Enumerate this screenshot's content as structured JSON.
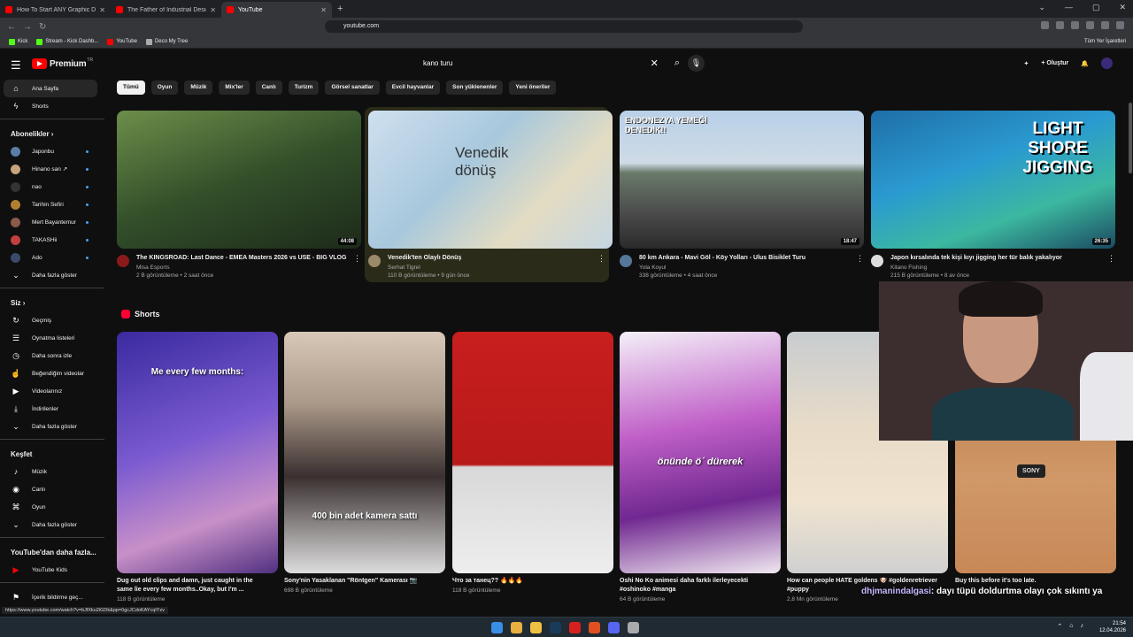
{
  "browser": {
    "tabs": [
      {
        "title": "How To Start ANY Graphic Design Fr",
        "active": false
      },
      {
        "title": "The Father of Industrial Design | Dier",
        "active": false
      },
      {
        "title": "YouTube",
        "active": true
      }
    ],
    "url": "youtube.com",
    "bookmarks": [
      "Kick",
      "Stream - Kick Dashb...",
      "YouTube",
      "Deco My Tree"
    ],
    "bookmarks_right": "Tüm Yer İşaretleri"
  },
  "header": {
    "logo_text": "Premium",
    "logo_tr": "TR",
    "search_query": "kano turu",
    "create_label": "Oluştur"
  },
  "sidebar": {
    "home": "Ana Sayfa",
    "shorts": "Shorts",
    "subs_title": "Abonelikler",
    "subs": [
      {
        "name": "Japonbu",
        "color": "#5a7ea8"
      },
      {
        "name": "Hinano san ↗",
        "color": "#c9a27e"
      },
      {
        "name": "nao",
        "color": "#333333"
      },
      {
        "name": "Tarihin Sefiri",
        "color": "#b08030"
      },
      {
        "name": "Mert Bayantemur",
        "color": "#8a5a4a"
      },
      {
        "name": "TAKASHii",
        "color": "#c04040"
      },
      {
        "name": "Ado",
        "color": "#3a4a6a"
      }
    ],
    "subs_more": "Daha fazla göster",
    "you_title": "Siz",
    "you": [
      {
        "label": "Geçmiş",
        "icon": "history-icon",
        "glyph": "↻"
      },
      {
        "label": "Oynatma listeleri",
        "icon": "playlists-icon",
        "glyph": "☰"
      },
      {
        "label": "Daha sonra izle",
        "icon": "clock-icon",
        "glyph": "◷"
      },
      {
        "label": "Beğendiğim videolar",
        "icon": "thumbs-up-icon",
        "glyph": "☝"
      },
      {
        "label": "Videolarınız",
        "icon": "your-videos-icon",
        "glyph": "▶"
      },
      {
        "label": "İndirilenler",
        "icon": "download-icon",
        "glyph": "⤓"
      },
      {
        "label": "Daha fazla göster",
        "icon": "chevron-down-icon",
        "glyph": "⌄"
      }
    ],
    "explore_title": "Keşfet",
    "explore": [
      {
        "label": "Müzik",
        "icon": "music-icon",
        "glyph": "♪"
      },
      {
        "label": "Canlı",
        "icon": "live-icon",
        "glyph": "◉"
      },
      {
        "label": "Oyun",
        "icon": "gaming-icon",
        "glyph": "⌘"
      },
      {
        "label": "Daha fazla göster",
        "icon": "chevron-down-icon",
        "glyph": "⌄"
      }
    ],
    "more_title": "YouTube'dan daha fazla...",
    "kids": "YouTube Kids",
    "report": "İçerik bildirme geç..."
  },
  "chips": [
    "Tümü",
    "Oyun",
    "Müzik",
    "Mix'ler",
    "Canlı",
    "Turizm",
    "Görsel sanatlar",
    "Evcil hayvanlar",
    "Son yüklenenler",
    "Yeni öneriler"
  ],
  "videos": [
    {
      "title": "The KINGSROAD: Last Dance - EMEA Masters 2026 vs USE - BIG VLOG",
      "channel": "Misa Esports",
      "stats": "2 B görüntüleme • 2 saat önce",
      "duration": "44:08",
      "thumb_text": ""
    },
    {
      "title": "Venedik'ten Olaylı Dönüş",
      "channel": "Serhat Tigrel",
      "stats": "110 B görüntüleme • 9 gün önce",
      "duration": "",
      "thumb_text": "Venedik dönüş"
    },
    {
      "title": "80 km Ankara - Mavi Göl - Köy Yolları - Ulus Bisiklet Turu",
      "channel": "Yola Koyul",
      "stats": "338 görüntüleme • 4 saat önce",
      "duration": "18:47",
      "thumb_text": "ENDONEZYA YEMEĞİ DENEDİK!!"
    },
    {
      "title": "Japon kırsalında tek kişi kıyı jigging her tür balık yakalıyor",
      "channel": "Kitano Fishing",
      "stats": "215 B görüntüleme • 8 av önce",
      "duration": "26:35",
      "thumb_text": "LIGHT SHORE JIGGING"
    }
  ],
  "shorts_title": "Shorts",
  "shorts": [
    {
      "title": "Dug out old clips and damn, just caught in the same lie every few months..Okay, but I'm ...",
      "stats": "118 B görüntüleme",
      "overlay": "Me every few months:"
    },
    {
      "title": "Sony'nin Yasaklanan \"Röntgen\" Kamerası 📷",
      "stats": "698 B görüntüleme",
      "overlay": "400 bin adet kamera sattı"
    },
    {
      "title": "Что за танец?? 🔥🔥🔥",
      "stats": "118 B görüntüleme",
      "overlay": ""
    },
    {
      "title": "Oshi No Ko animesi daha farklı ilerleyecekti #oshinoko #manga",
      "stats": "64 B görüntüleme",
      "overlay": "önünde ö´ dürerek"
    },
    {
      "title": "How can people HATE goldens 🐶 #goldenretriever #puppy",
      "stats": "2,8 Mn görüntüleme",
      "overlay": ""
    },
    {
      "title": "Buy this before it's too late.",
      "stats": "",
      "overlay": "SONY"
    }
  ],
  "chat": {
    "user": "dhjmanindalgasi",
    "message": ": dayı tüpü doldurtma olayı çok sıkıntı ya"
  },
  "status_url": "https://www.youtube.com/watch?v=bJfXku2iGDk&pp=0gcJCdoKAYcqIYzv",
  "tray": {
    "time": "21:54",
    "date": "12.04.2026"
  }
}
